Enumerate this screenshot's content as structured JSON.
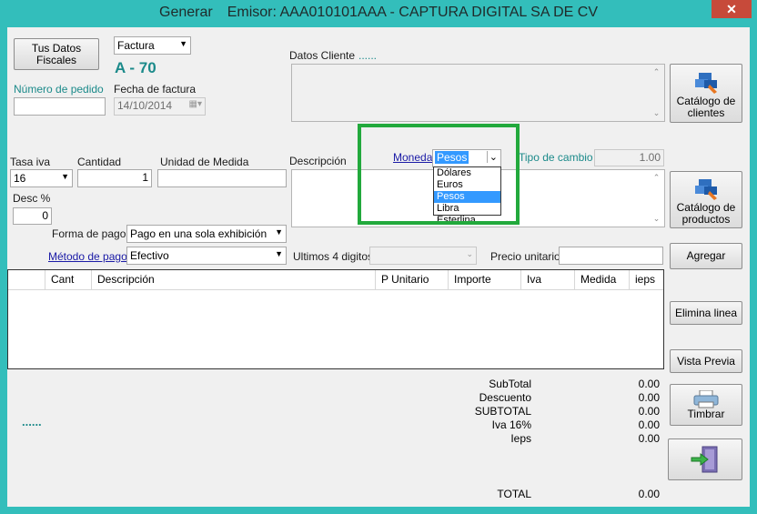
{
  "window": {
    "title_left": "Generar",
    "title_right": "Emisor: AAA010101AAA  -  CAPTURA DIGITAL SA DE CV",
    "close": "✕"
  },
  "header": {
    "fiscal_btn_line1": "Tus Datos",
    "fiscal_btn_line2": "Fiscales",
    "doc_type": "Factura",
    "folio": "A - 70",
    "order_label": "Número de pedido",
    "order_value": "",
    "date_label": "Fecha de factura",
    "date_value": "14/10/2014",
    "client_label": "Datos Cliente",
    "client_dots": "......",
    "client_catalog_line1": "Catálogo de",
    "client_catalog_line2": "clientes"
  },
  "item": {
    "iva_label": "Tasa iva",
    "iva_value": "16",
    "qty_label": "Cantidad",
    "qty_value": "1",
    "unit_label": "Unidad de Medida",
    "unit_value": "",
    "desc_label": "Descripción",
    "disc_label": "Desc %",
    "disc_value": "0",
    "currency_label": "Moneda",
    "currency_value": "Pesos",
    "currency_options": [
      "Dólares",
      "Euros",
      "Pesos",
      "Libra Esterlina"
    ],
    "rate_label": "Tipo de cambio",
    "rate_value": "1.00",
    "product_catalog_line1": "Catálogo de",
    "product_catalog_line2": "productos",
    "payment_form_label": "Forma de pago",
    "payment_form_value": "Pago en una sola exhibición",
    "payment_method_label": "Método de pago",
    "payment_method_value": "Efectivo",
    "last4_label": "Ultimos 4 digitos",
    "unit_price_label": "Precio unitario",
    "unit_price_value": "",
    "add_btn": "Agregar"
  },
  "grid": {
    "columns": [
      "Cant",
      "Descripción",
      "P Unitario",
      "Importe",
      "Iva",
      "Medida",
      "ieps"
    ]
  },
  "actions": {
    "remove_line": "Elimina linea",
    "preview": "Vista Previa",
    "stamp": "Timbrar"
  },
  "totals": {
    "dots": "......",
    "rows": [
      {
        "label": "SubTotal",
        "value": "0.00"
      },
      {
        "label": "Descuento",
        "value": "0.00"
      },
      {
        "label": "SUBTOTAL",
        "value": "0.00"
      },
      {
        "label": "Iva 16%",
        "value": "0.00"
      },
      {
        "label": "Ieps",
        "value": "0.00"
      }
    ],
    "total_label": "TOTAL",
    "total_value": "0.00"
  },
  "colors": {
    "title_bar": "#33bebb",
    "highlight_box": "#22a93c",
    "accent_teal": "#1b8a8a"
  }
}
